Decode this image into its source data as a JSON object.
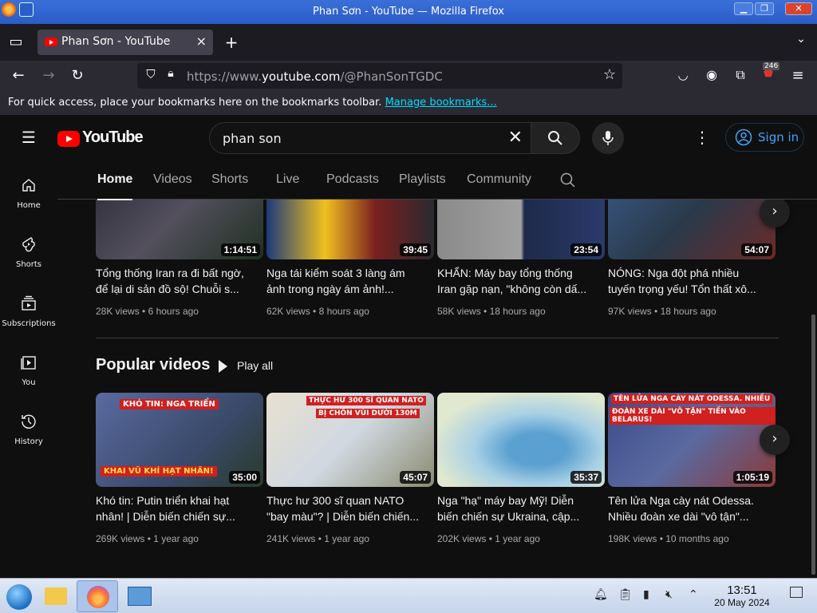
{
  "window": {
    "title": "Phan Sơn - YouTube — Mozilla Firefox"
  },
  "tab": {
    "label": "Phan Sơn - YouTube"
  },
  "urlbar": {
    "prefix": "https://www.",
    "domain": "youtube.com",
    "path": "/@PhanSonTGDC"
  },
  "bookmarks_bar": {
    "message": "For quick access, place your bookmarks here on the bookmarks toolbar.",
    "link": "Manage bookmarks..."
  },
  "extension_badge": "246",
  "youtube": {
    "logo": "YouTube",
    "search_value": "phan son",
    "signin": "Sign in",
    "guide": [
      {
        "label": "Home",
        "icon": "home-icon"
      },
      {
        "label": "Shorts",
        "icon": "shorts-icon"
      },
      {
        "label": "Subscriptions",
        "icon": "subscriptions-icon"
      },
      {
        "label": "You",
        "icon": "you-icon"
      },
      {
        "label": "History",
        "icon": "history-icon"
      }
    ],
    "channel_tabs": [
      "Home",
      "Videos",
      "Shorts",
      "Live",
      "Podcasts",
      "Playlists",
      "Community"
    ],
    "row1": [
      {
        "title1": "Tổng thống Iran ra đi bất ngờ,",
        "title2": "để lại di sản đồ sộ! Chuỗi s...",
        "views": "28K views",
        "age": "6 hours ago",
        "duration": "1:14:51",
        "bg": "#3b3a48"
      },
      {
        "title1": "Nga tái kiểm soát 3 làng ám",
        "title2": "ảnh trong ngày ám ảnh!...",
        "views": "62K views",
        "age": "8 hours ago",
        "duration": "39:45",
        "bg": "#4a3a30"
      },
      {
        "title1": "KHẨN: Máy bay tổng thống",
        "title2": "Iran gặp nạn, \"không còn dấ...",
        "views": "58K views",
        "age": "18 hours ago",
        "duration": "23:54",
        "bg": "#6a6a70"
      },
      {
        "title1": "NÓNG: Nga đột phá nhiều",
        "title2": "tuyến trọng yếu! Tổn thất xô...",
        "views": "97K views",
        "age": "18 hours ago",
        "duration": "54:07",
        "bg": "#3a4a5a"
      }
    ],
    "popular": {
      "title": "Popular videos",
      "play_all": "Play all",
      "videos": [
        {
          "title1": "Khó tin: Putin triển khai hạt",
          "title2": "nhân! | Diễn biến chiến sự...",
          "views": "269K views",
          "age": "1 year ago",
          "duration": "35:00",
          "bg": "#3c4c6a",
          "banner": "KHÓ TIN: NGA TRIỂN",
          "banner2": "KHAI VŨ KHÍ HẠT NHÂN!"
        },
        {
          "title1": "Thực hư 300 sĩ quan NATO",
          "title2": "\"bay màu\"? | Diễn biến chiến...",
          "views": "241K views",
          "age": "1 year ago",
          "duration": "45:07",
          "bg": "#d9d6cc",
          "banner": "THỰC HƯ 300 SĨ QUAN NATO",
          "banner2": "BỊ CHÔN VÙI DƯỚI 130M"
        },
        {
          "title1": "Nga \"hạ\" máy bay Mỹ! Diễn",
          "title2": "biến chiến sự Ukraina, cập...",
          "views": "202K views",
          "age": "1 year ago",
          "duration": "35:37",
          "bg": "#b9d6e6",
          "banner": "",
          "banner2": ""
        },
        {
          "title1": "Tên lửa Nga cày nát Odessa.",
          "title2": "Nhiều đoàn xe dài \"vô tận\"...",
          "views": "198K views",
          "age": "10 months ago",
          "duration": "1:05:19",
          "bg": "#3b4a78",
          "banner": "TÊN LỬA NGA CÀY NÁT ODESSA. NHIỀU",
          "banner2": "ĐOÀN XE DÀI \"VÔ TẬN\" TIẾN VÀO BELARUS!"
        }
      ]
    }
  },
  "taskbar": {
    "time": "13:51",
    "date": "20 May 2024"
  },
  "colors": {
    "yt_red": "#ff0000",
    "link_blue": "#3ea6ff",
    "bg": "#0f0f0f"
  }
}
